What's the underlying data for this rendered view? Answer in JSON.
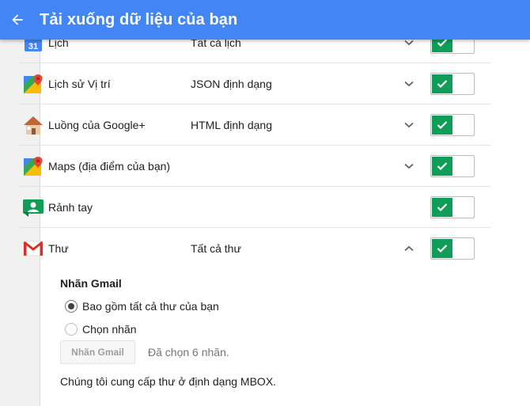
{
  "header": {
    "title": "Tải xuống dữ liệu của bạn",
    "back_icon": "arrow-back-icon"
  },
  "accent": "#4285f4",
  "toggle_color": "#0f9d58",
  "calendar_icon_text": "31",
  "rows": [
    {
      "name": "Lịch",
      "format": "Tất cả lịch",
      "chevron": "down",
      "enabled": true,
      "icon": "calendar-icon"
    },
    {
      "name": "Lịch sử Vị trí",
      "format": "JSON định dạng",
      "chevron": "down",
      "enabled": true,
      "icon": "maps-pin-icon"
    },
    {
      "name": "Luồng của Google+",
      "format": "HTML định dạng",
      "chevron": "down",
      "enabled": true,
      "icon": "house-icon"
    },
    {
      "name": "Maps (địa điểm của bạn)",
      "format": "",
      "chevron": "down",
      "enabled": true,
      "icon": "maps-pin-icon"
    },
    {
      "name": "Rảnh tay",
      "format": "",
      "chevron": "",
      "enabled": true,
      "icon": "handsfree-icon"
    },
    {
      "name": "Thư",
      "format": "Tất cả thư",
      "chevron": "up",
      "enabled": true,
      "icon": "gmail-icon"
    }
  ],
  "gmail_options": {
    "section_label": "Nhãn Gmail",
    "options": [
      {
        "label": "Bao gồm tất cả thư của bạn",
        "selected": true
      },
      {
        "label": "Chọn nhãn",
        "selected": false
      }
    ],
    "label_button": "Nhãn Gmail",
    "selected_count_text": "Đã chọn 6 nhãn.",
    "mbox_note": "Chúng tôi cung cấp thư ở định dạng MBOX."
  }
}
